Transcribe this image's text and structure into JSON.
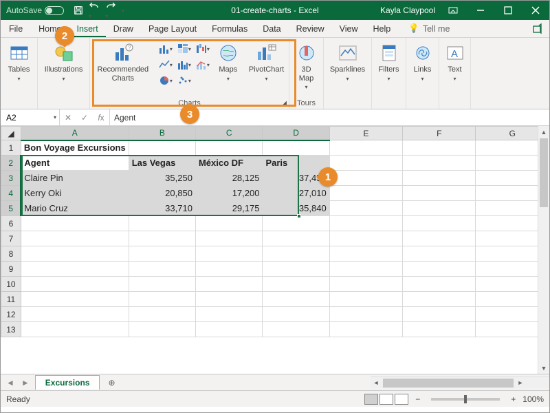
{
  "titlebar": {
    "autosave_label": "AutoSave",
    "title": "01-create-charts - Excel",
    "user": "Kayla Claypool"
  },
  "tabs": {
    "file": "File",
    "home": "Home",
    "insert": "Insert",
    "draw": "Draw",
    "page_layout": "Page Layout",
    "formulas": "Formulas",
    "data": "Data",
    "review": "Review",
    "view": "View",
    "help": "Help",
    "tell_me": "Tell me"
  },
  "ribbon": {
    "tables": "Tables",
    "illustrations": "Illustrations",
    "recommended_charts": "Recommended\nCharts",
    "maps": "Maps",
    "pivotchart": "PivotChart",
    "charts_group": "Charts",
    "tours_group": "Tours",
    "three_d_map": "3D\nMap",
    "sparklines": "Sparklines",
    "filters": "Filters",
    "links": "Links",
    "text": "Text"
  },
  "namebox": "A2",
  "formula": "Agent",
  "headers": [
    "A",
    "B",
    "C",
    "D",
    "E",
    "F",
    "G"
  ],
  "rows": [
    "1",
    "2",
    "3",
    "4",
    "5",
    "6",
    "7",
    "8",
    "9",
    "10",
    "11",
    "12",
    "13"
  ],
  "data": {
    "title": "Bon Voyage Excursions",
    "hdr": [
      "Agent",
      "Las Vegas",
      "México DF",
      "Paris"
    ],
    "r3": [
      "Claire Pin",
      "35,250",
      "28,125",
      "37,455"
    ],
    "r4": [
      "Kerry Oki",
      "20,850",
      "17,200",
      "27,010"
    ],
    "r5": [
      "Mario Cruz",
      "33,710",
      "29,175",
      "35,840"
    ]
  },
  "sheet": {
    "name": "Excursions"
  },
  "status": {
    "ready": "Ready",
    "zoom": "100%"
  },
  "callouts": {
    "one": "1",
    "two": "2",
    "three": "3"
  },
  "colwidths": {
    "rowhead": 30,
    "A": 101,
    "B": 101,
    "C": 101,
    "D": 101,
    "narrow": 101
  }
}
